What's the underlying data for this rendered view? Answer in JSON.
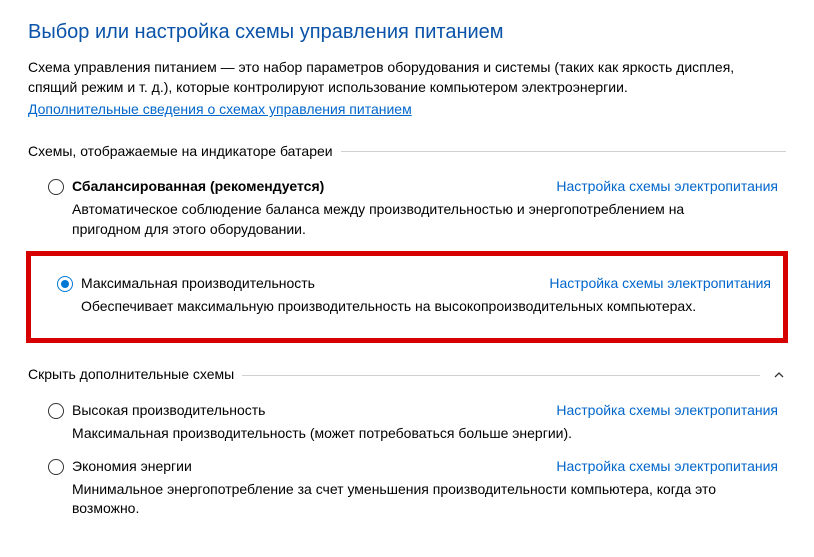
{
  "title": "Выбор или настройка схемы управления питанием",
  "intro": "Схема управления питанием — это набор параметров оборудования и системы (таких как яркость дисплея, спящий режим и т. д.), которые контролируют использование компьютером электроэнергии.",
  "more_link": "Дополнительные сведения о схемах управления питанием",
  "section1_label": "Схемы, отображаемые на индикаторе батареи",
  "section2_label": "Скрыть дополнительные схемы",
  "config_link": "Настройка схемы электропитания",
  "plans": {
    "balanced": {
      "name": "Сбалансированная (рекомендуется)",
      "desc": "Автоматическое соблюдение баланса между производительностью и энергопотреблением на пригодном для этого оборудовании."
    },
    "maxperf": {
      "name": "Максимальная производительность",
      "desc": "Обеспечивает максимальную производительность на высокопроизводительных компьютерах."
    },
    "highperf": {
      "name": "Высокая производительность",
      "desc": "Максимальная производительность (может потребоваться больше энергии)."
    },
    "powersaver": {
      "name": "Экономия энергии",
      "desc": "Минимальное энергопотребление за счет уменьшения производительности компьютера, когда это возможно."
    }
  }
}
